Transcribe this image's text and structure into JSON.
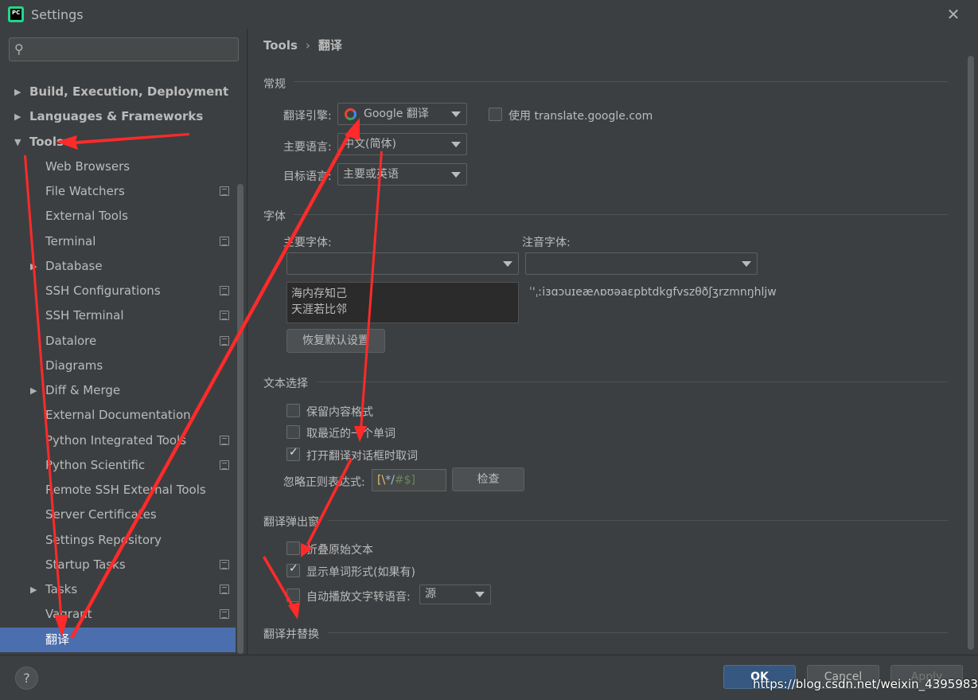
{
  "window": {
    "title": "Settings",
    "app_icon_text": "PC"
  },
  "sidebar": {
    "search_placeholder": "",
    "items": [
      {
        "label": "Build, Execution, Deployment",
        "bold": true,
        "arrow": "▶"
      },
      {
        "label": "Languages & Frameworks",
        "bold": true,
        "arrow": "▶"
      },
      {
        "label": "Tools",
        "bold": true,
        "arrow": "▼"
      },
      {
        "label": "Web Browsers"
      },
      {
        "label": "File Watchers",
        "project": true
      },
      {
        "label": "External Tools"
      },
      {
        "label": "Terminal",
        "project": true
      },
      {
        "label": "Database",
        "arrow": "▶"
      },
      {
        "label": "SSH Configurations",
        "project": true
      },
      {
        "label": "SSH Terminal",
        "project": true
      },
      {
        "label": "Datalore",
        "project": true
      },
      {
        "label": "Diagrams"
      },
      {
        "label": "Diff & Merge",
        "arrow": "▶"
      },
      {
        "label": "External Documentation"
      },
      {
        "label": "Python Integrated Tools",
        "project": true
      },
      {
        "label": "Python Scientific",
        "project": true
      },
      {
        "label": "Remote SSH External Tools"
      },
      {
        "label": "Server Certificates"
      },
      {
        "label": "Settings Repository"
      },
      {
        "label": "Startup Tasks",
        "project": true
      },
      {
        "label": "Tasks",
        "arrow": "▶",
        "project": true
      },
      {
        "label": "Vagrant",
        "project": true
      },
      {
        "label": "翻译",
        "selected": true
      }
    ]
  },
  "breadcrumb": {
    "parent": "Tools",
    "separator": "›",
    "current": "翻译"
  },
  "general": {
    "title": "常规",
    "engine_label": "翻译引擎:",
    "engine_value": "Google 翻译",
    "use_google_com_label": "使用 translate.google.com",
    "primary_lang_label": "主要语言:",
    "primary_lang_value": "中文(简体)",
    "target_lang_label": "目标语言:",
    "target_lang_value": "主要或英语"
  },
  "font": {
    "title": "字体",
    "primary_font_label": "主要字体:",
    "phonetic_font_label": "注音字体:",
    "preview_line1": "海内存知己",
    "preview_line2": "天涯若比邻",
    "phonetic_preview": "ˈ'ˌːiɜɑɔuɪeæʌɒʊəaɛpbtdkgfvszθðʃʒrzmnŋhljw",
    "reset_button": "恢复默认设置"
  },
  "text_selection": {
    "title": "文本选择",
    "keep_format": "保留内容格式",
    "take_nearest_word": "取最近的一个单词",
    "take_word_on_open": "打开翻译对话框时取词",
    "ignore_regex_label": "忽略正则表达式:",
    "regex_part1": "[\\",
    "regex_part2": "*/",
    "regex_part3": "#$]",
    "check_button": "检查"
  },
  "popup": {
    "title": "翻译弹出窗",
    "fold_original": "折叠原始文本",
    "show_word_forms": "显示单词形式(如果有)",
    "auto_tts": "自动播放文字转语音:",
    "tts_value": "源"
  },
  "replace": {
    "title": "翻译并替换"
  },
  "footer": {
    "help": "?",
    "ok": "OK",
    "cancel": "Cancel",
    "apply": "Apply",
    "watermark": "https://blog.csdn.net/weixin_43959833"
  },
  "colors": {
    "accent_selected": "#4b6eaf",
    "annotation_arrow": "#ff2a2a",
    "ok_button": "#365880"
  }
}
